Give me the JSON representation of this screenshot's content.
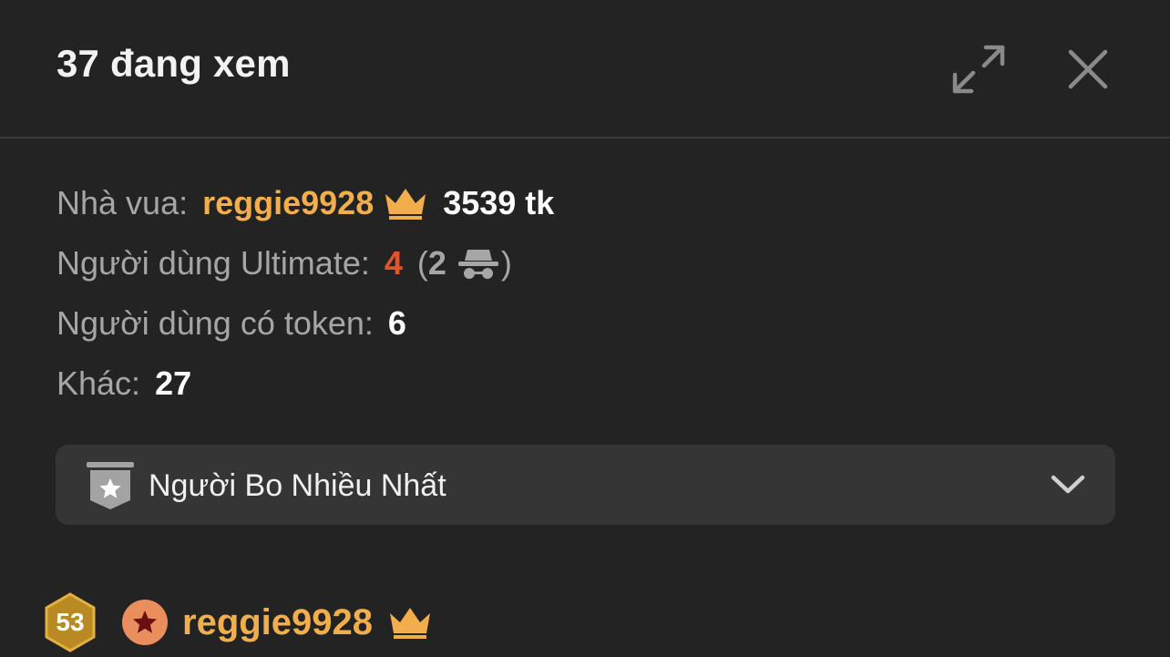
{
  "header": {
    "title": "37 đang xem"
  },
  "stats": {
    "king": {
      "label": "Nhà vua:",
      "username": "reggie9928",
      "tokens": "3539 tk"
    },
    "ultimate": {
      "label": "Người dùng Ultimate:",
      "count": "4",
      "paren_open": "(",
      "anonymous_count": "2",
      "paren_close": ")"
    },
    "token_users": {
      "label": "Người dùng có token:",
      "count": "6"
    },
    "others": {
      "label": "Khác:",
      "count": "27"
    }
  },
  "sort_dropdown": {
    "selected": "Người Bo Nhiều Nhất"
  },
  "viewers": [
    {
      "level": "53",
      "username": "reggie9928"
    }
  ],
  "colors": {
    "background": "#232323",
    "gold": "#f2ae4b",
    "ultimate_red": "#e2542b",
    "label_gray": "#a6a6a6"
  },
  "icons": {
    "expand": "expand-icon",
    "close": "close-icon",
    "crown": "crown-icon",
    "anonymous": "incognito-icon",
    "sort_badge": "star-badge-icon",
    "chevron": "chevron-down-icon",
    "fan_star": "star-icon"
  }
}
